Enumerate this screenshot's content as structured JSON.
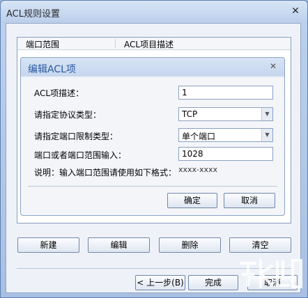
{
  "window": {
    "title": "ACL规则设置",
    "close_glyph": "✕"
  },
  "list": {
    "columns": [
      "端口范围",
      "ACL项目描述"
    ]
  },
  "dialog": {
    "title": "编辑ACL项",
    "close_glyph": "✕",
    "fields": [
      {
        "label": "ACL项描述：",
        "value": "1",
        "type": "text"
      },
      {
        "label": "请指定协议类型：",
        "value": "TCP",
        "type": "select"
      },
      {
        "label": "请指定端口限制类型：",
        "value": "单个端口",
        "type": "select"
      },
      {
        "label": "端口或者端口范围输入：",
        "value": "1028",
        "type": "text"
      }
    ],
    "hint_label": "说明：输入端口范围请使用如下格式：",
    "hint_value": "xxxx-xxxx",
    "ok_label": "确定",
    "cancel_label": "取消"
  },
  "actions": {
    "new_label": "新建",
    "edit_label": "编辑",
    "delete_label": "删除",
    "clear_label": "清空"
  },
  "wizard": {
    "back_label": "< 上一步(B)",
    "finish_label": "完成",
    "cancel_label": "取消"
  },
  "colors": {
    "title_blue": "#2a5aa0",
    "frame": "#5a7fb3"
  }
}
